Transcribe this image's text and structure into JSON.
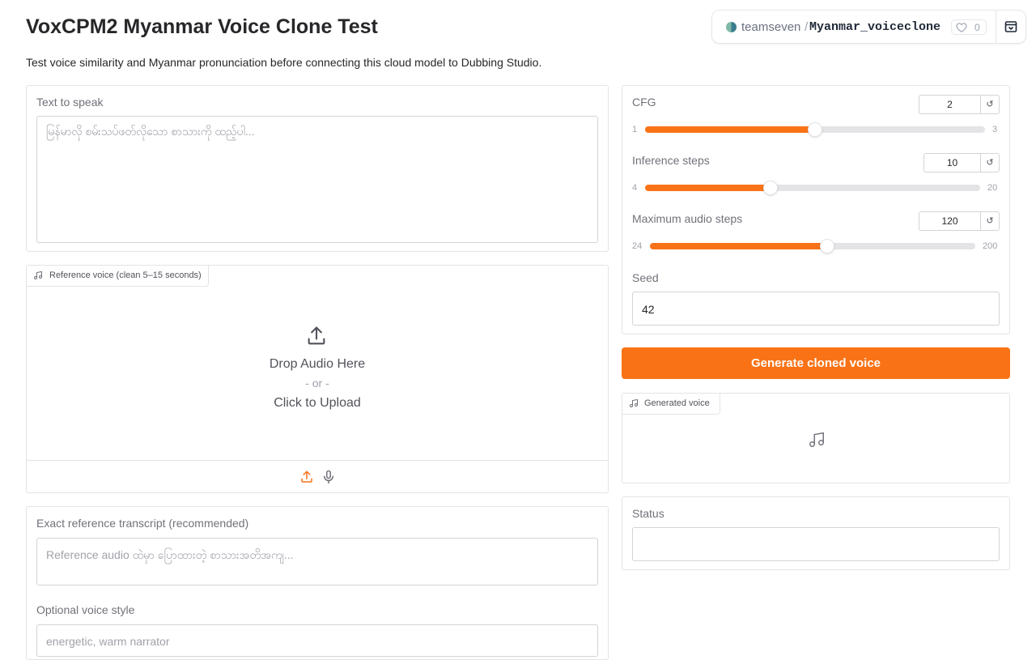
{
  "header": {
    "title": "VoxCPM2 Myanmar Voice Clone Test",
    "description": "Test voice similarity and Myanmar pronunciation before connecting this cloud model to Dubbing Studio."
  },
  "space_badge": {
    "owner": "teamseven",
    "separator": "/",
    "space_name": "Myanmar_voiceclone",
    "likes": "0",
    "icons": [
      "like-heart-icon",
      "collapse-header-icon"
    ]
  },
  "text_to_speak": {
    "label": "Text to speak",
    "placeholder": "မြန်မာလို စမ်းသပ်ဖတ်လိုသော စာသားကို ထည့်ပါ..."
  },
  "reference_voice": {
    "label": "Reference voice (clean 5–15 seconds)",
    "drop_text": "Drop Audio Here",
    "or_text": "- or -",
    "upload_text": "Click to Upload",
    "icons": [
      "music-note-icon",
      "upload-icon",
      "microphone-icon"
    ]
  },
  "reference_transcript": {
    "label": "Exact reference transcript (recommended)",
    "placeholder": "Reference audio ထဲမှာ ပြောထားတဲ့ စာသားအတိအကျ..."
  },
  "voice_style": {
    "label": "Optional voice style",
    "placeholder": "energetic, warm narrator"
  },
  "sliders": {
    "cfg": {
      "label": "CFG",
      "value": "2",
      "min": "1",
      "max": "3",
      "fraction": 0.5,
      "reset_icon": "↺"
    },
    "inference_steps": {
      "label": "Inference steps",
      "value": "10",
      "min": "4",
      "max": "20",
      "fraction": 0.375,
      "reset_icon": "↺"
    },
    "max_audio_steps": {
      "label": "Maximum audio steps",
      "value": "120",
      "min": "24",
      "max": "200",
      "fraction": 0.545,
      "reset_icon": "↺"
    }
  },
  "seed": {
    "label": "Seed",
    "value": "42"
  },
  "generate_button": {
    "label": "Generate cloned voice"
  },
  "generated_voice": {
    "label": "Generated voice"
  },
  "status": {
    "label": "Status",
    "value": ""
  },
  "colors": {
    "accent": "#f97316",
    "border": "#e4e4e7",
    "text": "#27272a",
    "muted": "#71717a"
  }
}
